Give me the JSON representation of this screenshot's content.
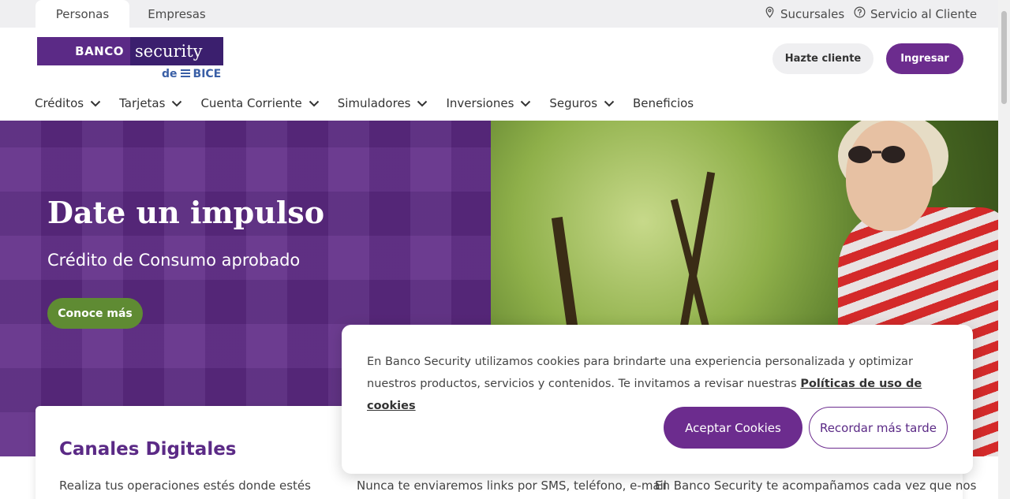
{
  "topbar": {
    "tabs": [
      {
        "label": "Personas",
        "active": true
      },
      {
        "label": "Empresas",
        "active": false
      }
    ],
    "links": [
      {
        "label": "Sucursales",
        "icon": "map-pin-icon"
      },
      {
        "label": "Servicio al Cliente",
        "icon": "help-circle-icon"
      }
    ]
  },
  "logo": {
    "banco": "BANCO",
    "security": "security",
    "de": "de",
    "bice": "BICE",
    "colors": {
      "primary": "#5b2a86",
      "secondary": "#3b1f6e",
      "bice": "#3a5fa6"
    }
  },
  "header": {
    "hazte_label": "Hazte cliente",
    "ingresar_label": "Ingresar"
  },
  "nav": {
    "items": [
      {
        "label": "Créditos",
        "has_dropdown": true
      },
      {
        "label": "Tarjetas",
        "has_dropdown": true
      },
      {
        "label": "Cuenta Corriente",
        "has_dropdown": true
      },
      {
        "label": "Simuladores",
        "has_dropdown": true
      },
      {
        "label": "Inversiones",
        "has_dropdown": true
      },
      {
        "label": "Seguros",
        "has_dropdown": true
      },
      {
        "label": "Beneficios",
        "has_dropdown": false
      }
    ]
  },
  "hero": {
    "title": "Date un impulso",
    "subtitle": "Crédito de Consumo aprobado",
    "cta_label": "Conoce más",
    "colors": {
      "background": "#5e2a85",
      "cta": "#5f8b33"
    }
  },
  "cards": {
    "title": "Canales Digitales",
    "texts": [
      "Realiza tus operaciones estés donde estés",
      "Nunca te enviaremos links por SMS, teléfono, e-mail",
      "En Banco Security te acompañamos cada vez que nos"
    ]
  },
  "cookie_banner": {
    "text": "En Banco Security utilizamos cookies para brindarte una experiencia personalizada y optimizar nuestros productos, servicios y contenidos. Te invitamos a revisar nuestras",
    "link_label": "Políticas de uso de cookies",
    "accept_label": "Aceptar Cookies",
    "later_label": "Recordar más tarde",
    "accent": "#6c2c8e"
  }
}
